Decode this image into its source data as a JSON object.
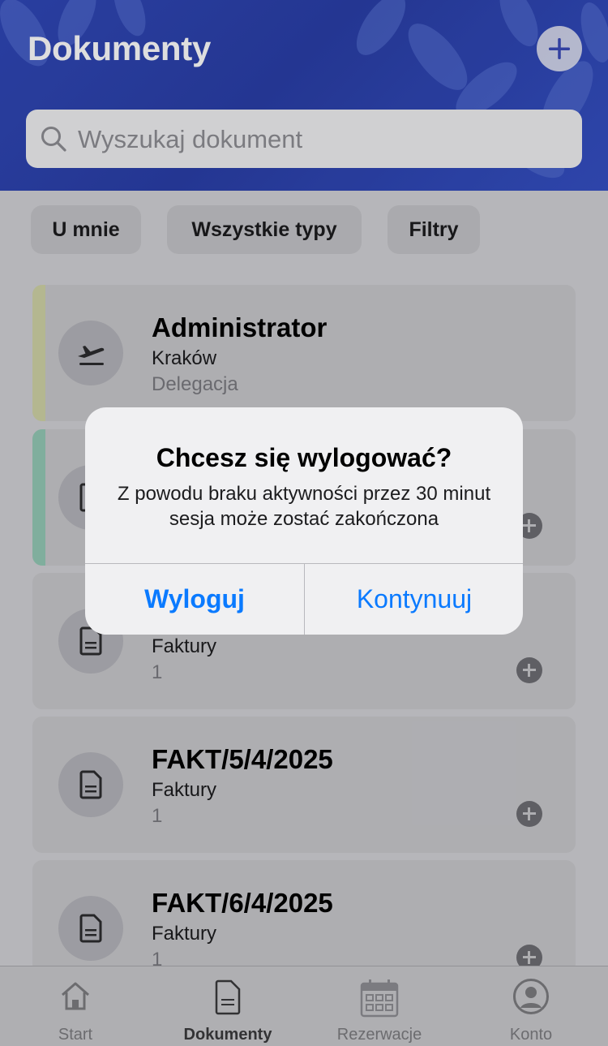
{
  "header": {
    "title": "Dokumenty",
    "add_icon": "plus-circle-icon"
  },
  "search": {
    "placeholder": "Wyszukaj dokument",
    "icon": "search-icon"
  },
  "filters": [
    {
      "label": "U mnie"
    },
    {
      "label": "Wszystkie typy"
    },
    {
      "label": "Filtry"
    }
  ],
  "documents": [
    {
      "title": "Administrator",
      "subtitle": "Kraków",
      "meta": "Delegacja",
      "icon": "airplane-takeoff-icon",
      "stripe_color": "#cfd3a6"
    },
    {
      "title": "",
      "subtitle": "",
      "meta": "",
      "icon": "document-icon",
      "stripe_color": "#93c8b5"
    },
    {
      "title": "",
      "subtitle": "Faktury",
      "meta": "1",
      "icon": "document-icon"
    },
    {
      "title": "FAKT/5/4/2025",
      "subtitle": "Faktury",
      "meta": "1",
      "icon": "document-icon"
    },
    {
      "title": "FAKT/6/4/2025",
      "subtitle": "Faktury",
      "meta": "1",
      "icon": "document-icon"
    }
  ],
  "dialog": {
    "title": "Chcesz się wylogować?",
    "message": "Z powodu braku aktywności przez 30 minut sesja może zostać zakończona",
    "logout_label": "Wyloguj",
    "continue_label": "Kontynuuj"
  },
  "tabbar": [
    {
      "label": "Start",
      "icon": "home-icon"
    },
    {
      "label": "Dokumenty",
      "icon": "document-icon",
      "active": true
    },
    {
      "label": "Rezerwacje",
      "icon": "calendar-icon"
    },
    {
      "label": "Konto",
      "icon": "account-icon"
    }
  ],
  "colors": {
    "accent": "#0a7aff",
    "header": "#2f46b3"
  }
}
